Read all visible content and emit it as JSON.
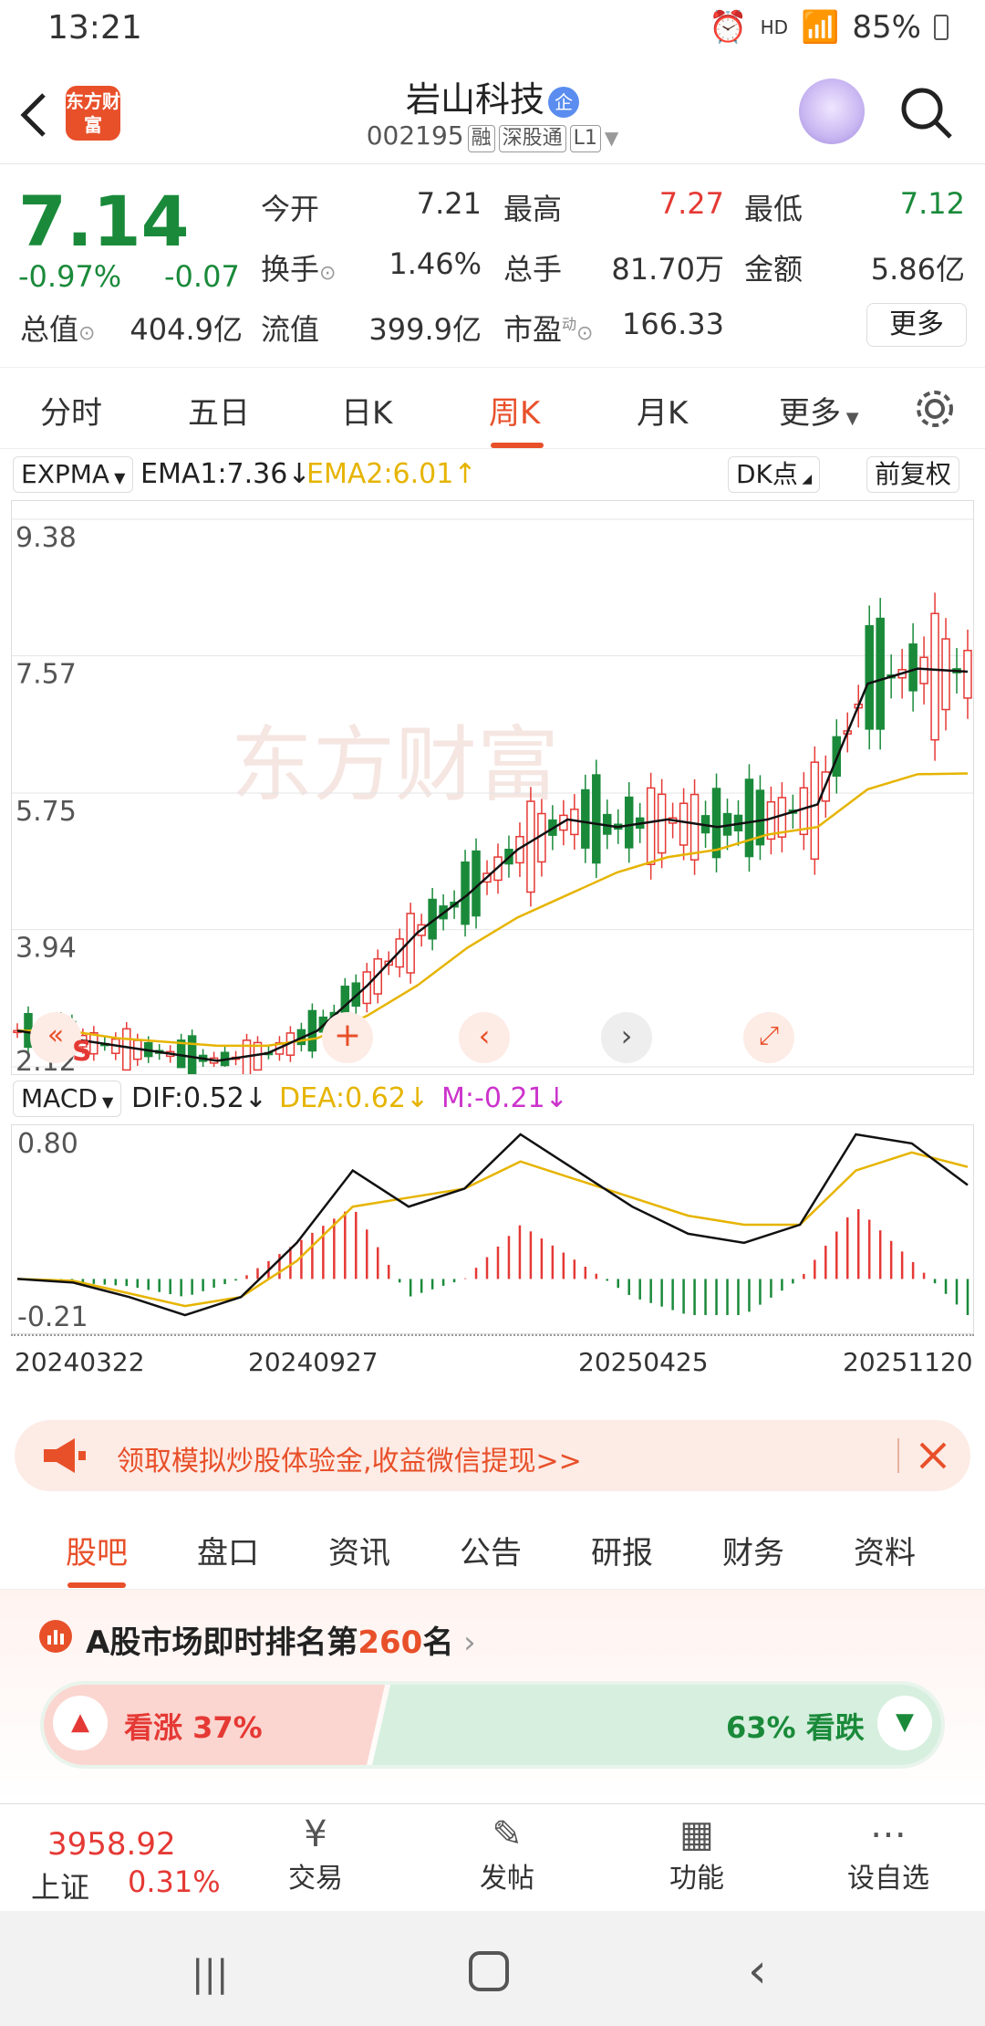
{
  "status_bar": {
    "time": "13:21",
    "indicators": "HD",
    "battery": "85%"
  },
  "header": {
    "logo_text": "东方财富",
    "stock_name": "岩山科技",
    "badge": "企",
    "stock_code": "002195",
    "tags": [
      "融",
      "深股通",
      "L1"
    ]
  },
  "quote": {
    "price": "7.14",
    "change_pct": "-0.97%",
    "change": "-0.07",
    "stats": [
      {
        "label": "今开",
        "value": "7.21",
        "color": "#333333"
      },
      {
        "label": "最高",
        "value": "7.27",
        "color": "#e53935"
      },
      {
        "label": "最低",
        "value": "7.12",
        "color": "#1a8a3a"
      },
      {
        "label": "换手",
        "value": "1.46%",
        "color": "#333333"
      },
      {
        "label": "总手",
        "value": "81.70万",
        "color": "#333333"
      },
      {
        "label": "金额",
        "value": "5.86亿",
        "color": "#333333"
      },
      {
        "label": "总值",
        "value": "404.9亿",
        "color": "#333333"
      },
      {
        "label": "流值",
        "value": "399.9亿",
        "color": "#333333"
      },
      {
        "label": "市盈",
        "value": "166.33",
        "color": "#333333"
      }
    ],
    "pe_superscript": "动",
    "more_button": "更多"
  },
  "chart_tabs": [
    "分时",
    "五日",
    "日K",
    "周K",
    "月K",
    "更多"
  ],
  "chart_tab_active": "周K",
  "indicator_bar": {
    "selector": "EXPMA",
    "ema1": "EMA1:7.36",
    "ema2": "EMA2:6.01",
    "dk_button": "DK点",
    "adjust_button": "前复权"
  },
  "kline": {
    "price_labels": [
      "9.38",
      "7.57",
      "5.75",
      "3.94",
      "2.12"
    ],
    "signal_marker": "S",
    "watermark": "东方财富"
  },
  "macd_bar": {
    "selector": "MACD",
    "dif": "DIF:0.52",
    "dea": "DEA:0.62",
    "m": "M:-0.21"
  },
  "macd": {
    "labels": [
      "0.80",
      "-0.21"
    ]
  },
  "dates": [
    "20240322",
    "20240927",
    "20250425",
    "20251120"
  ],
  "chart_data": [
    {
      "type": "candlestick",
      "title": "",
      "ylim": [
        2.12,
        9.38
      ],
      "x": [
        "20240322",
        "20240927",
        "20250425",
        "20251120"
      ],
      "series": [
        {
          "name": "EMA1:7.36",
          "values_approx": [
            2.6,
            2.5,
            2.4,
            2.3,
            2.2,
            2.3,
            2.6,
            3.2,
            3.9,
            4.4,
            5.0,
            5.4,
            5.3,
            5.4,
            5.3,
            5.4,
            5.6,
            7.2,
            7.4,
            7.36
          ]
        },
        {
          "name": "EMA2:6.01",
          "values_approx": [
            2.6,
            2.6,
            2.5,
            2.45,
            2.4,
            2.4,
            2.5,
            2.8,
            3.2,
            3.7,
            4.1,
            4.4,
            4.7,
            4.9,
            5.0,
            5.2,
            5.3,
            5.8,
            6.0,
            6.01
          ]
        }
      ]
    },
    {
      "type": "bar",
      "title": "",
      "ylim": [
        -0.21,
        0.8
      ],
      "series": [
        {
          "name": "DIF:0.52",
          "values_approx": [
            0.0,
            -0.02,
            -0.1,
            -0.2,
            -0.1,
            0.2,
            0.6,
            0.4,
            0.5,
            0.8,
            0.6,
            0.4,
            0.25,
            0.2,
            0.3,
            0.8,
            0.75,
            0.52
          ]
        },
        {
          "name": "DEA:0.62",
          "values_approx": [
            0.0,
            -0.01,
            -0.08,
            -0.15,
            -0.1,
            0.1,
            0.4,
            0.45,
            0.5,
            0.65,
            0.55,
            0.45,
            0.35,
            0.3,
            0.3,
            0.6,
            0.7,
            0.62
          ]
        }
      ]
    }
  ],
  "promo": {
    "text": "领取模拟炒股体验金,收益微信提现>>"
  },
  "content_tabs": [
    "股吧",
    "盘口",
    "资讯",
    "公告",
    "研报",
    "财务",
    "资料"
  ],
  "content_tab_active": "股吧",
  "rank": {
    "prefix": "A股市场即时排名第",
    "number": "260",
    "suffix": "名"
  },
  "vote": {
    "up": "看涨 37%",
    "down": "63% 看跌",
    "up_ratio": 0.37
  },
  "bottom_bar": {
    "index_value": "3958.92",
    "index_name": "上证",
    "index_change": "0.31%",
    "items": [
      "交易",
      "发帖",
      "功能",
      "设自选"
    ]
  },
  "colors": {
    "accent": "#e8502a",
    "up": "#e53935",
    "down": "#1a8a3a",
    "ema2": "#e6b400",
    "macd_m": "#cc33cc"
  }
}
